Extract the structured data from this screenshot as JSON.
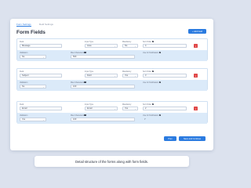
{
  "tabs": [
    "Form Settings",
    "Field Settings"
  ],
  "title": "Form Fields",
  "add_button": "+ Add Field",
  "labels": {
    "field": "Field",
    "input_type": "Input Type",
    "mandatory": "Mandatory",
    "sort_order": "Sort Order",
    "validation": "Validation",
    "max_characters": "Max Characters",
    "use_for_notification": "Use for Notification"
  },
  "fields": [
    {
      "name": "Message",
      "input_type": "Area",
      "mandatory": "No",
      "sort_order": "4",
      "validation": "No",
      "max_characters": "500",
      "notification_status": ""
    },
    {
      "name": "Subject",
      "input_type": "Field",
      "mandatory": "Yes",
      "sort_order": "3",
      "validation": "No",
      "max_characters": "100",
      "notification_status": ""
    },
    {
      "name": "Email",
      "input_type": "Email",
      "mandatory": "Yes",
      "sort_order": "2",
      "validation": "Yes",
      "max_characters": "100",
      "notification_status": "Y"
    }
  ],
  "footer": {
    "prev_label": "Prev",
    "save_label": "Save and Continue"
  },
  "caption": "Detail structure of the forms along with form fields.",
  "colors": {
    "accent": "#2b7be0",
    "delete": "#e04848",
    "row_highlight": "#dbeaf9"
  }
}
